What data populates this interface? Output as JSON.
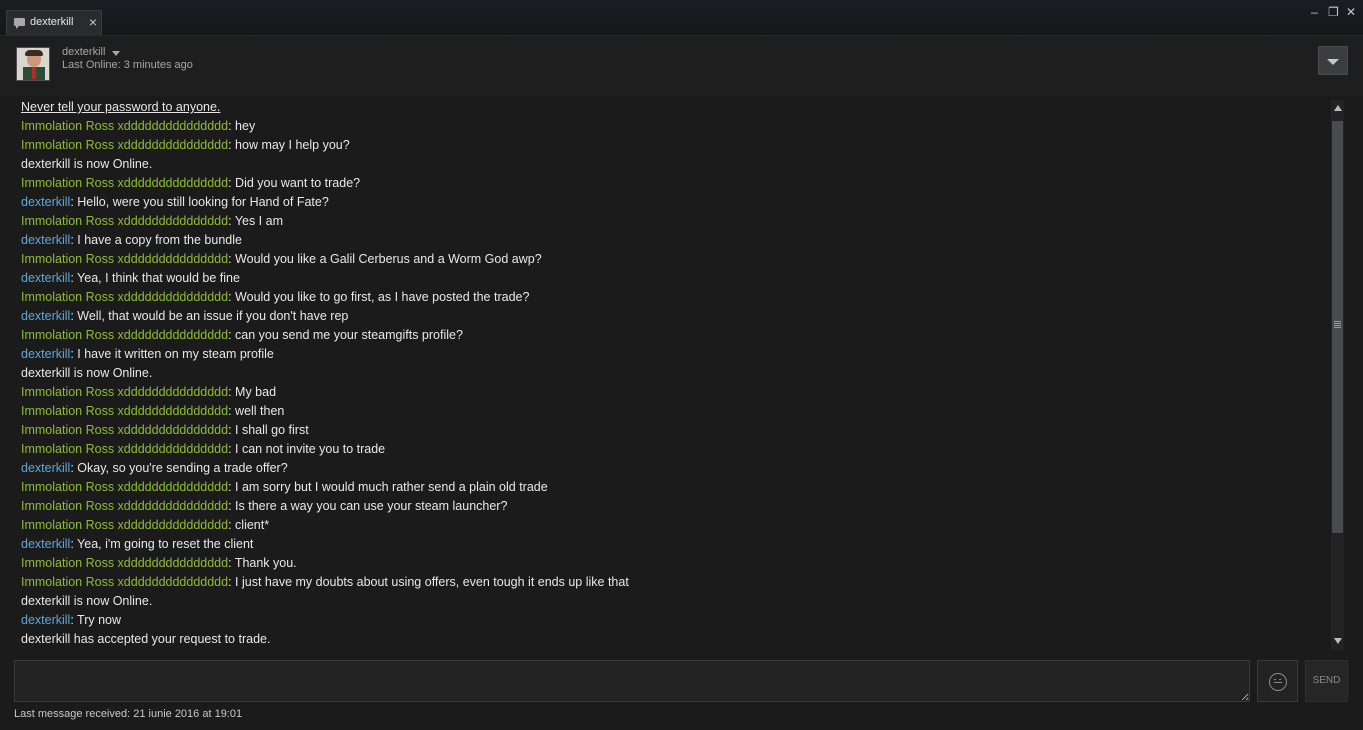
{
  "tab": {
    "label": "dexterkill",
    "close": "×"
  },
  "window": {
    "minimize": "–",
    "restore": "❐",
    "close": "✕"
  },
  "header": {
    "persona_name": "dexterkill",
    "last_online": "Last Online: 3 minutes ago"
  },
  "messages": [
    {
      "type": "warn",
      "text": "Never tell your password to anyone."
    },
    {
      "type": "them",
      "name": "Immolation Ross xddddddddddddddd",
      "text": ": hey"
    },
    {
      "type": "them",
      "name": "Immolation Ross xddddddddddddddd",
      "text": ": how may I help you?"
    },
    {
      "type": "sys",
      "text": "dexterkill is now Online."
    },
    {
      "type": "them",
      "name": "Immolation Ross xddddddddddddddd",
      "text": ": Did you want to trade?"
    },
    {
      "type": "me",
      "name": "dexterkill",
      "text": ": Hello, were you still looking for Hand of Fate?"
    },
    {
      "type": "them",
      "name": "Immolation Ross xddddddddddddddd",
      "text": ": Yes I am"
    },
    {
      "type": "me",
      "name": "dexterkill",
      "text": ": I have a copy from the bundle"
    },
    {
      "type": "them",
      "name": "Immolation Ross xddddddddddddddd",
      "text": ": Would you like a Galil Cerberus and a Worm God awp?"
    },
    {
      "type": "me",
      "name": "dexterkill",
      "text": ": Yea, I think that would be fine"
    },
    {
      "type": "them",
      "name": "Immolation Ross xddddddddddddddd",
      "text": ": Would you like to go first, as I have posted the trade?"
    },
    {
      "type": "me",
      "name": "dexterkill",
      "text": ": Well, that would be an issue if you don't have rep"
    },
    {
      "type": "them",
      "name": "Immolation Ross xddddddddddddddd",
      "text": ": can you send me your steamgifts profile?"
    },
    {
      "type": "me",
      "name": "dexterkill",
      "text": ": I have it written on my steam profile"
    },
    {
      "type": "sys",
      "text": "dexterkill is now Online."
    },
    {
      "type": "them",
      "name": "Immolation Ross xddddddddddddddd",
      "text": ": My bad"
    },
    {
      "type": "them",
      "name": "Immolation Ross xddddddddddddddd",
      "text": ": well then"
    },
    {
      "type": "them",
      "name": "Immolation Ross xddddddddddddddd",
      "text": ": I shall go first"
    },
    {
      "type": "them",
      "name": "Immolation Ross xddddddddddddddd",
      "text": ": I can not invite you to trade"
    },
    {
      "type": "me",
      "name": "dexterkill",
      "text": ": Okay, so you're sending a trade offer?"
    },
    {
      "type": "them",
      "name": "Immolation Ross xddddddddddddddd",
      "text": ": I am sorry but I would much rather send a plain old trade"
    },
    {
      "type": "them",
      "name": "Immolation Ross xddddddddddddddd",
      "text": ": Is there a way you can use your steam launcher?"
    },
    {
      "type": "them",
      "name": "Immolation Ross xddddddddddddddd",
      "text": ": client*"
    },
    {
      "type": "me",
      "name": "dexterkill",
      "text": ": Yea, i'm going to reset the client"
    },
    {
      "type": "them",
      "name": "Immolation Ross xddddddddddddddd",
      "text": ": Thank you."
    },
    {
      "type": "them",
      "name": "Immolation Ross xddddddddddddddd",
      "text": ": I just have my doubts about using offers, even tough it ends up like that"
    },
    {
      "type": "sys",
      "text": "dexterkill is now Online."
    },
    {
      "type": "me",
      "name": "dexterkill",
      "text": ": Try now"
    },
    {
      "type": "sys",
      "text": "dexterkill has accepted your request to trade."
    }
  ],
  "composer": {
    "value": "",
    "send_label": "SEND"
  },
  "footer": {
    "last_message": "Last message received: 21 iunie 2016 at 19:01"
  },
  "colors": {
    "them": "#8fbc35",
    "me": "#62a7d8",
    "background": "#1b1b1b"
  }
}
